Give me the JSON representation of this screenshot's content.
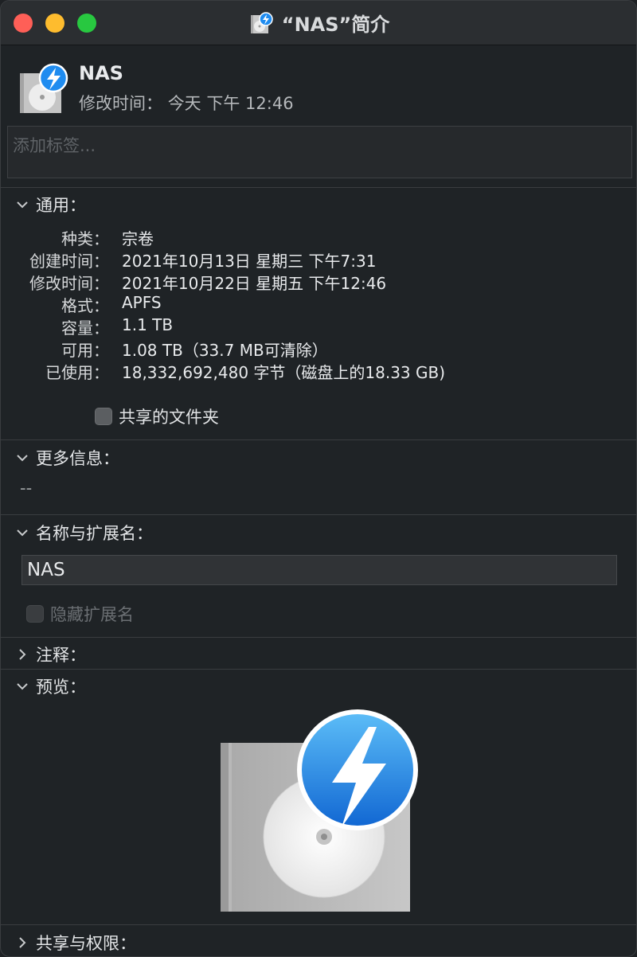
{
  "window": {
    "title": "“NAS”简介",
    "icon": "disk-image-icon"
  },
  "header": {
    "name": "NAS",
    "modified_label": "修改时间：",
    "modified_value": "今天 下午 12:46",
    "icon": "dmg-volume-icon"
  },
  "tags": {
    "placeholder": "添加标签..."
  },
  "general": {
    "title": "通用：",
    "rows": [
      {
        "label": "种类：",
        "value": "宗卷"
      },
      {
        "label": "创建时间：",
        "value": "2021年10月13日 星期三 下午7:31"
      },
      {
        "label": "修改时间：",
        "value": "2021年10月22日 星期五 下午12:46"
      },
      {
        "label": "格式：",
        "value": "APFS"
      },
      {
        "label": "容量：",
        "value": "1.1 TB"
      },
      {
        "label": "可用：",
        "value": "1.08 TB（33.7 MB可清除）"
      },
      {
        "label": "已使用：",
        "value": "18,332,692,480 字节（磁盘上的18.33 GB)"
      }
    ],
    "shared_folder_label": "共享的文件夹",
    "shared_folder_checked": false
  },
  "more_info": {
    "title": "更多信息：",
    "value": "--"
  },
  "name_ext": {
    "title": "名称与扩展名：",
    "value": "NAS",
    "hide_ext_label": "隐藏扩展名",
    "hide_ext_checked": false
  },
  "comments": {
    "title": "注释："
  },
  "preview": {
    "title": "预览："
  },
  "sharing": {
    "title": "共享与权限："
  },
  "colors": {
    "accent_blue": "#1f8cf0",
    "close": "#fe5f57",
    "minimize": "#febc2e",
    "maximize": "#28c840"
  }
}
